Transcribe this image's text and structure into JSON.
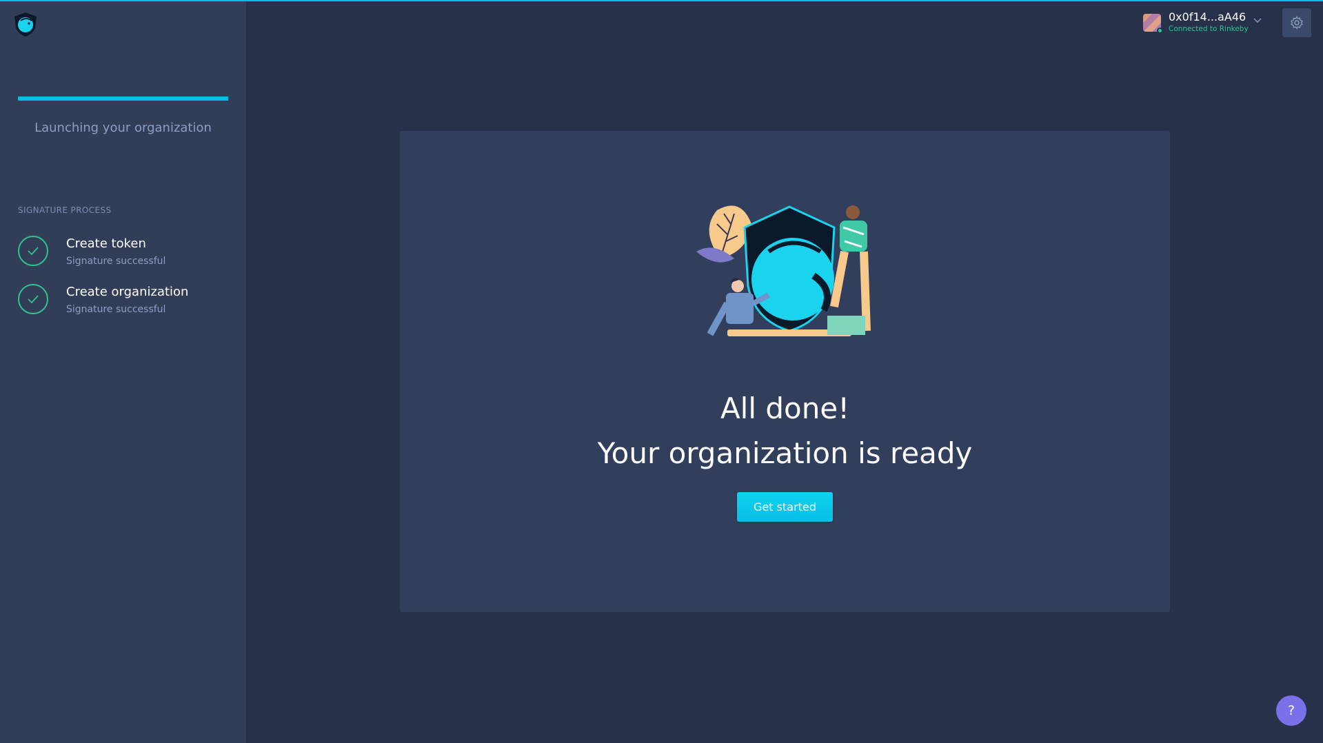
{
  "sidebar": {
    "title": "Launching your organization",
    "section_label": "SIGNATURE PROCESS",
    "steps": [
      {
        "title": "Create token",
        "status": "Signature successful"
      },
      {
        "title": "Create organization",
        "status": "Signature successful"
      }
    ]
  },
  "header": {
    "account_name": "0x0f14...aA46",
    "account_status": "Connected to Rinkeby"
  },
  "main": {
    "heading": "All done!",
    "subheading": "Your organization is ready",
    "cta_label": "Get started"
  },
  "help": {
    "label": "?"
  },
  "colors": {
    "accent": "#08bee5",
    "success": "#2cc68f",
    "background": "#27314a",
    "sidebar": "#323e58",
    "card": "#323f5c",
    "help": "#7a70e8"
  }
}
